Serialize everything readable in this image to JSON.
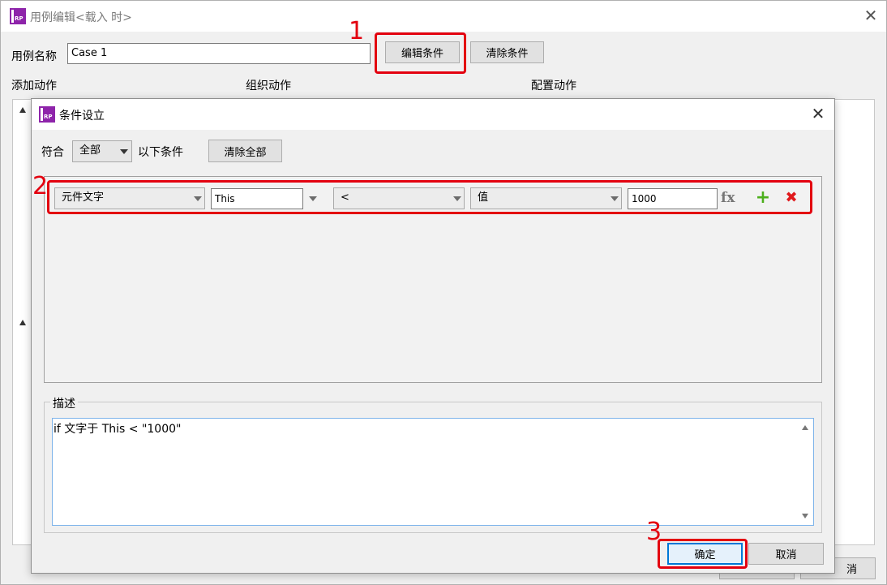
{
  "outer": {
    "title": "用例编辑<载入 时>",
    "case_name_label": "用例名称",
    "case_name_value": "Case 1",
    "edit_condition_button": "编辑条件",
    "clear_condition_button": "清除条件",
    "col_add_action": "添加动作",
    "col_organize_action": "组织动作",
    "col_configure_action": "配置动作",
    "bottom_cancel_partial": "消"
  },
  "dialog": {
    "title": "条件设立",
    "match_label": "符合",
    "match_value": "全部",
    "match_suffix": "以下条件",
    "clear_all_button": "清除全部",
    "condition_row": {
      "target": "元件文字",
      "object": "This",
      "operator": "<",
      "value_type": "值",
      "value": "1000"
    },
    "desc_label": "描述",
    "desc_text": "if 文字于 This < \"1000\"",
    "ok_button": "确定",
    "cancel_button": "取消"
  },
  "annotations": {
    "step1": "1",
    "step2": "2",
    "step3": "3"
  },
  "colors": {
    "annotation_red": "#e3000f",
    "accent_blue": "#0078d7",
    "add_green": "#4caf1c",
    "delete_red": "#e0191c",
    "app_icon_purple": "#8e24aa"
  }
}
